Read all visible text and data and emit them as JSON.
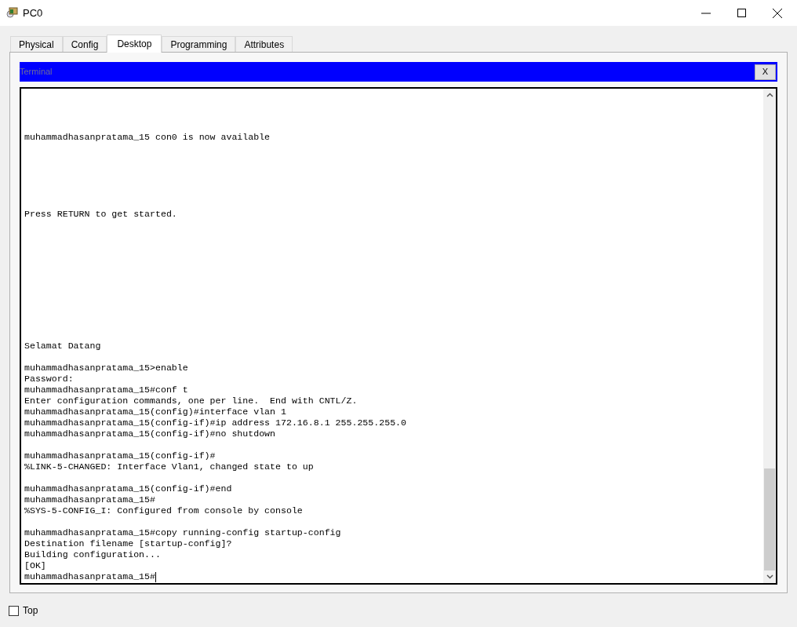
{
  "window": {
    "title": "PC0"
  },
  "tabs": [
    {
      "label": "Physical",
      "selected": false
    },
    {
      "label": "Config",
      "selected": false
    },
    {
      "label": "Desktop",
      "selected": true
    },
    {
      "label": "Programming",
      "selected": false
    },
    {
      "label": "Attributes",
      "selected": false
    }
  ],
  "terminal": {
    "title": "Terminal",
    "close_label": "X",
    "lines": [
      {
        "kind": "text",
        "text": "muhammadhasanpratama_15 con0 is now available"
      },
      {
        "kind": "blank"
      },
      {
        "kind": "blank"
      },
      {
        "kind": "blank"
      },
      {
        "kind": "blank"
      },
      {
        "kind": "blank"
      },
      {
        "kind": "blank"
      },
      {
        "kind": "text",
        "text": "Press RETURN to get started."
      },
      {
        "kind": "blank"
      },
      {
        "kind": "blank"
      },
      {
        "kind": "blank"
      },
      {
        "kind": "blank"
      },
      {
        "kind": "blank"
      },
      {
        "kind": "blank"
      },
      {
        "kind": "blank"
      },
      {
        "kind": "blank"
      },
      {
        "kind": "blank"
      },
      {
        "kind": "blank"
      },
      {
        "kind": "blank"
      },
      {
        "kind": "text",
        "text": "Selamat Datang"
      },
      {
        "kind": "blank"
      },
      {
        "kind": "text",
        "text": "muhammadhasanpratama_15>enable"
      },
      {
        "kind": "text",
        "text": "Password:"
      },
      {
        "kind": "text",
        "text": "muhammadhasanpratama_15#conf t"
      },
      {
        "kind": "text",
        "text": "Enter configuration commands, one per line.  End with CNTL/Z."
      },
      {
        "kind": "text",
        "text": "muhammadhasanpratama_15(config)#interface vlan 1"
      },
      {
        "kind": "text",
        "text": "muhammadhasanpratama_15(config-if)#ip address 172.16.8.1 255.255.255.0"
      },
      {
        "kind": "text",
        "text": "muhammadhasanpratama_15(config-if)#no shutdown"
      },
      {
        "kind": "blank"
      },
      {
        "kind": "text",
        "text": "muhammadhasanpratama_15(config-if)#"
      },
      {
        "kind": "text",
        "text": "%LINK-5-CHANGED: Interface Vlan1, changed state to up"
      },
      {
        "kind": "blank"
      },
      {
        "kind": "text",
        "text": "muhammadhasanpratama_15(config-if)#end"
      },
      {
        "kind": "text",
        "text": "muhammadhasanpratama_15#"
      },
      {
        "kind": "text",
        "text": "%SYS-5-CONFIG_I: Configured from console by console"
      },
      {
        "kind": "blank"
      },
      {
        "kind": "text",
        "text": "muhammadhasanpratama_15#copy running-config startup-config"
      },
      {
        "kind": "text",
        "text": "Destination filename [startup-config]?"
      },
      {
        "kind": "text",
        "text": "Building configuration..."
      },
      {
        "kind": "text",
        "text": "[OK]"
      },
      {
        "kind": "prompt",
        "text": "muhammadhasanpratama_15#"
      }
    ]
  },
  "top_checkbox": {
    "label": "Top",
    "checked": false
  }
}
